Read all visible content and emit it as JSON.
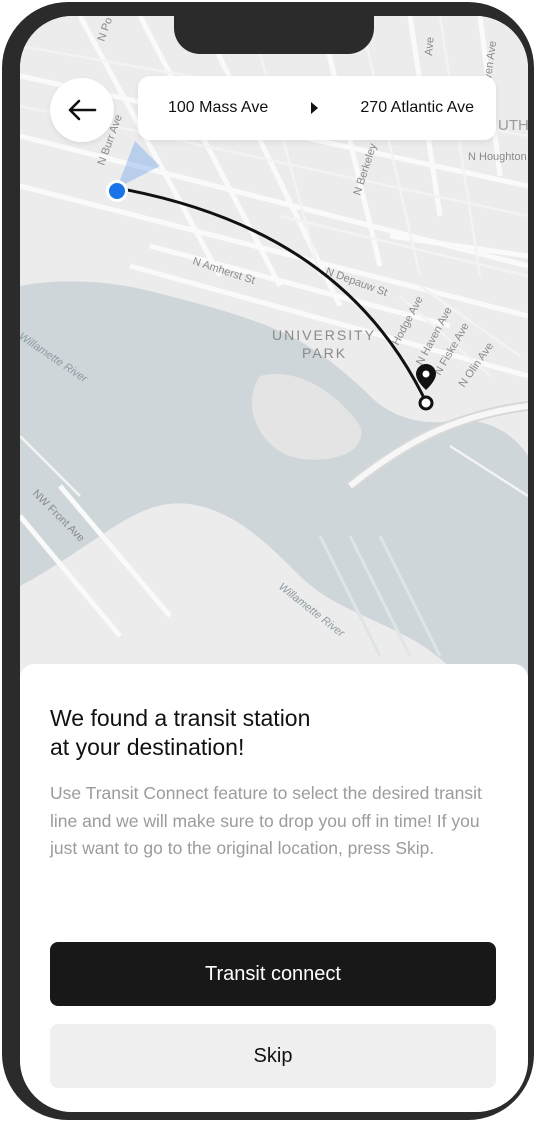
{
  "route": {
    "origin": "100 Mass Ave",
    "destination": "270 Atlantic Ave"
  },
  "map": {
    "street_labels": [
      "N Burr Ave",
      "N Amherst St",
      "N Depauw St",
      "N Berkeley",
      "N Houghton",
      "Hodge Ave",
      "N Haven Ave",
      "N Fiske Ave",
      "N Olin Ave",
      "NW Front Ave",
      "Willamette River",
      "Willamette River",
      "N Po",
      "Ave",
      "aven Ave",
      "UTH"
    ],
    "district_label_1": "UNIVERSITY",
    "district_label_2": "PARK",
    "colors": {
      "land": "#ececec",
      "water": "#cfd6da",
      "road": "#fafafa",
      "route": "#111111",
      "origin_dot": "#1a73e8"
    }
  },
  "sheet": {
    "title_line1": "We found a transit station",
    "title_line2": "at your destination!",
    "description": "Use Transit Connect feature to select the desired transit line and we will make sure to drop you off in time! If you just want to go to the original location, press Skip.",
    "primary_button": "Transit connect",
    "secondary_button": "Skip"
  },
  "icons": {
    "back": "arrow-left-icon",
    "separator": "triangle-right-icon",
    "destination": "map-pin-icon"
  }
}
